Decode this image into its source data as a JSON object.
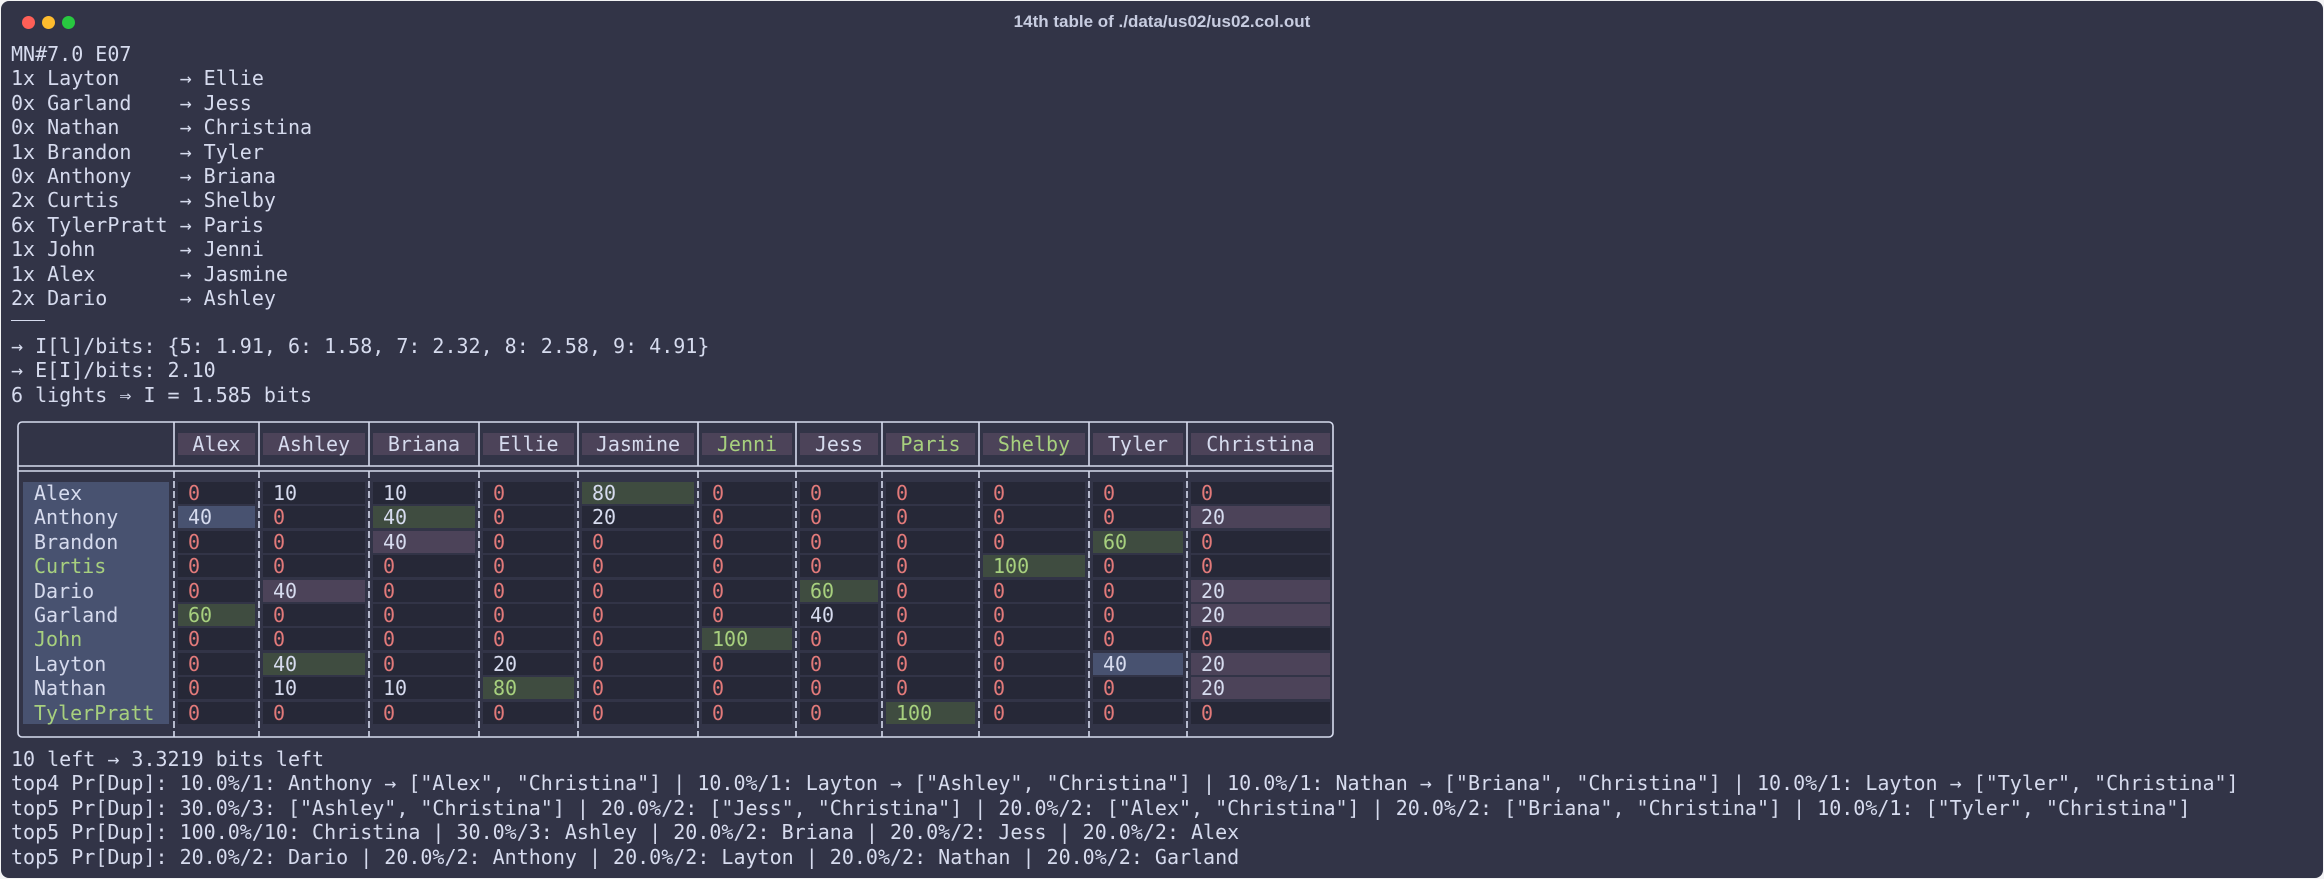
{
  "window": {
    "title": "14th table of ./data/us02/us02.col.out"
  },
  "colors": {
    "background": "#323447",
    "text": "#d6dbee",
    "zero": "#e27a7a",
    "match": "#a7d07e",
    "green_cell": "#3f4c40",
    "pink_cell": "#4c4359",
    "blue_cell": "#485270",
    "dark_cell": "#262837"
  },
  "header_lines": [
    "MN#7.0 E07",
    "1x Layton     → Ellie",
    "0x Garland    → Jess",
    "0x Nathan     → Christina",
    "1x Brandon    → Tyler",
    "0x Anthony    → Briana",
    "2x Curtis     → Shelby",
    "6x TylerPratt → Paris",
    "1x John       → Jenni",
    "1x Alex       → Jasmine",
    "2x Dario      → Ashley"
  ],
  "info_lines": [
    "→ I[l]/bits: {5: 1.91, 6: 1.58, 7: 2.32, 8: 2.58, 9: 4.91}",
    "→ E[I]/bits: 2.10",
    "6 lights ⇒ I = 1.585 bits"
  ],
  "table": {
    "columns": [
      {
        "label": "Alex",
        "style": "normal"
      },
      {
        "label": "Ashley",
        "style": "normal"
      },
      {
        "label": "Briana",
        "style": "normal"
      },
      {
        "label": "Ellie",
        "style": "normal"
      },
      {
        "label": "Jasmine",
        "style": "normal"
      },
      {
        "label": "Jenni",
        "style": "match"
      },
      {
        "label": "Jess",
        "style": "normal"
      },
      {
        "label": "Paris",
        "style": "match"
      },
      {
        "label": "Shelby",
        "style": "match"
      },
      {
        "label": "Tyler",
        "style": "normal"
      },
      {
        "label": "Christina",
        "style": "normal"
      }
    ],
    "rows": [
      {
        "label": "Alex",
        "style": "normal",
        "cells": [
          {
            "v": "0",
            "s": "zero"
          },
          {
            "v": "10",
            "s": "plain"
          },
          {
            "v": "10",
            "s": "plain"
          },
          {
            "v": "0",
            "s": "zero"
          },
          {
            "v": "80",
            "s": "green"
          },
          {
            "v": "0",
            "s": "zero"
          },
          {
            "v": "0",
            "s": "zero"
          },
          {
            "v": "0",
            "s": "zero"
          },
          {
            "v": "0",
            "s": "zero"
          },
          {
            "v": "0",
            "s": "zero"
          },
          {
            "v": "0",
            "s": "zero"
          }
        ]
      },
      {
        "label": "Anthony",
        "style": "normal",
        "cells": [
          {
            "v": "40",
            "s": "blue"
          },
          {
            "v": "0",
            "s": "zero"
          },
          {
            "v": "40",
            "s": "green"
          },
          {
            "v": "0",
            "s": "zero"
          },
          {
            "v": "20",
            "s": "plain"
          },
          {
            "v": "0",
            "s": "zero"
          },
          {
            "v": "0",
            "s": "zero"
          },
          {
            "v": "0",
            "s": "zero"
          },
          {
            "v": "0",
            "s": "zero"
          },
          {
            "v": "0",
            "s": "zero"
          },
          {
            "v": "20",
            "s": "pink"
          }
        ]
      },
      {
        "label": "Brandon",
        "style": "normal",
        "cells": [
          {
            "v": "0",
            "s": "zero"
          },
          {
            "v": "0",
            "s": "zero"
          },
          {
            "v": "40",
            "s": "pink"
          },
          {
            "v": "0",
            "s": "zero"
          },
          {
            "v": "0",
            "s": "zero"
          },
          {
            "v": "0",
            "s": "zero"
          },
          {
            "v": "0",
            "s": "zero"
          },
          {
            "v": "0",
            "s": "zero"
          },
          {
            "v": "0",
            "s": "zero"
          },
          {
            "v": "60",
            "s": "green-match"
          },
          {
            "v": "0",
            "s": "zero"
          }
        ]
      },
      {
        "label": "Curtis",
        "style": "match",
        "cells": [
          {
            "v": "0",
            "s": "zero"
          },
          {
            "v": "0",
            "s": "zero"
          },
          {
            "v": "0",
            "s": "zero"
          },
          {
            "v": "0",
            "s": "zero"
          },
          {
            "v": "0",
            "s": "zero"
          },
          {
            "v": "0",
            "s": "zero"
          },
          {
            "v": "0",
            "s": "zero"
          },
          {
            "v": "0",
            "s": "zero"
          },
          {
            "v": "100",
            "s": "green-match"
          },
          {
            "v": "0",
            "s": "zero"
          },
          {
            "v": "0",
            "s": "zero"
          }
        ]
      },
      {
        "label": "Dario",
        "style": "normal",
        "cells": [
          {
            "v": "0",
            "s": "zero"
          },
          {
            "v": "40",
            "s": "pink"
          },
          {
            "v": "0",
            "s": "zero"
          },
          {
            "v": "0",
            "s": "zero"
          },
          {
            "v": "0",
            "s": "zero"
          },
          {
            "v": "0",
            "s": "zero"
          },
          {
            "v": "60",
            "s": "green-match"
          },
          {
            "v": "0",
            "s": "zero"
          },
          {
            "v": "0",
            "s": "zero"
          },
          {
            "v": "0",
            "s": "zero"
          },
          {
            "v": "20",
            "s": "pink"
          }
        ]
      },
      {
        "label": "Garland",
        "style": "normal",
        "cells": [
          {
            "v": "60",
            "s": "green-match"
          },
          {
            "v": "0",
            "s": "zero"
          },
          {
            "v": "0",
            "s": "zero"
          },
          {
            "v": "0",
            "s": "zero"
          },
          {
            "v": "0",
            "s": "zero"
          },
          {
            "v": "0",
            "s": "zero"
          },
          {
            "v": "40",
            "s": "plain"
          },
          {
            "v": "0",
            "s": "zero"
          },
          {
            "v": "0",
            "s": "zero"
          },
          {
            "v": "0",
            "s": "zero"
          },
          {
            "v": "20",
            "s": "pink"
          }
        ]
      },
      {
        "label": "John",
        "style": "match",
        "cells": [
          {
            "v": "0",
            "s": "zero"
          },
          {
            "v": "0",
            "s": "zero"
          },
          {
            "v": "0",
            "s": "zero"
          },
          {
            "v": "0",
            "s": "zero"
          },
          {
            "v": "0",
            "s": "zero"
          },
          {
            "v": "100",
            "s": "green-match"
          },
          {
            "v": "0",
            "s": "zero"
          },
          {
            "v": "0",
            "s": "zero"
          },
          {
            "v": "0",
            "s": "zero"
          },
          {
            "v": "0",
            "s": "zero"
          },
          {
            "v": "0",
            "s": "zero"
          }
        ]
      },
      {
        "label": "Layton",
        "style": "normal",
        "cells": [
          {
            "v": "0",
            "s": "zero"
          },
          {
            "v": "40",
            "s": "green"
          },
          {
            "v": "0",
            "s": "zero"
          },
          {
            "v": "20",
            "s": "plain"
          },
          {
            "v": "0",
            "s": "zero"
          },
          {
            "v": "0",
            "s": "zero"
          },
          {
            "v": "0",
            "s": "zero"
          },
          {
            "v": "0",
            "s": "zero"
          },
          {
            "v": "0",
            "s": "zero"
          },
          {
            "v": "40",
            "s": "blue"
          },
          {
            "v": "20",
            "s": "pink"
          }
        ]
      },
      {
        "label": "Nathan",
        "style": "normal",
        "cells": [
          {
            "v": "0",
            "s": "zero"
          },
          {
            "v": "10",
            "s": "plain"
          },
          {
            "v": "10",
            "s": "plain"
          },
          {
            "v": "80",
            "s": "green-match"
          },
          {
            "v": "0",
            "s": "zero"
          },
          {
            "v": "0",
            "s": "zero"
          },
          {
            "v": "0",
            "s": "zero"
          },
          {
            "v": "0",
            "s": "zero"
          },
          {
            "v": "0",
            "s": "zero"
          },
          {
            "v": "0",
            "s": "zero"
          },
          {
            "v": "20",
            "s": "pink"
          }
        ]
      },
      {
        "label": "TylerPratt",
        "style": "match",
        "cells": [
          {
            "v": "0",
            "s": "zero"
          },
          {
            "v": "0",
            "s": "zero"
          },
          {
            "v": "0",
            "s": "zero"
          },
          {
            "v": "0",
            "s": "zero"
          },
          {
            "v": "0",
            "s": "zero"
          },
          {
            "v": "0",
            "s": "zero"
          },
          {
            "v": "0",
            "s": "zero"
          },
          {
            "v": "100",
            "s": "green-match"
          },
          {
            "v": "0",
            "s": "zero"
          },
          {
            "v": "0",
            "s": "zero"
          },
          {
            "v": "0",
            "s": "zero"
          }
        ]
      }
    ]
  },
  "footer_lines": [
    "10 left → 3.3219 bits left",
    "top4 Pr[Dup]: 10.0%/1: Anthony → [\"Alex\", \"Christina\"] | 10.0%/1: Layton → [\"Ashley\", \"Christina\"] | 10.0%/1: Nathan → [\"Briana\", \"Christina\"] | 10.0%/1: Layton → [\"Tyler\", \"Christina\"]",
    "top5 Pr[Dup]: 30.0%/3: [\"Ashley\", \"Christina\"] | 20.0%/2: [\"Jess\", \"Christina\"] | 20.0%/2: [\"Alex\", \"Christina\"] | 20.0%/2: [\"Briana\", \"Christina\"] | 10.0%/1: [\"Tyler\", \"Christina\"]",
    "top5 Pr[Dup]: 100.0%/10: Christina | 30.0%/3: Ashley | 20.0%/2: Briana | 20.0%/2: Jess | 20.0%/2: Alex",
    "top5 Pr[Dup]: 20.0%/2: Dario | 20.0%/2: Anthony | 20.0%/2: Layton | 20.0%/2: Nathan | 20.0%/2: Garland"
  ]
}
